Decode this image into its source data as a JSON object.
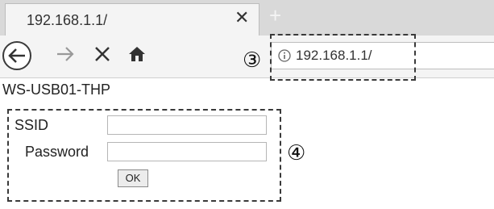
{
  "browser": {
    "tab": {
      "title": "192.168.1.1/",
      "close_icon": "close-icon"
    },
    "new_tab_glyph": "+",
    "nav": {
      "back_icon": "back-arrow-icon",
      "forward_icon": "forward-arrow-icon",
      "stop_icon": "stop-icon",
      "home_icon": "home-icon"
    },
    "url": {
      "info_icon": "info-icon",
      "text": "192.168.1.1/"
    }
  },
  "callouts": {
    "address": "③",
    "form": "④"
  },
  "page": {
    "title": "WS-USB01-THP",
    "form": {
      "ssid_label": "SSID",
      "ssid_value": "",
      "password_label": "Password",
      "password_value": "",
      "ok_label": "OK"
    }
  }
}
